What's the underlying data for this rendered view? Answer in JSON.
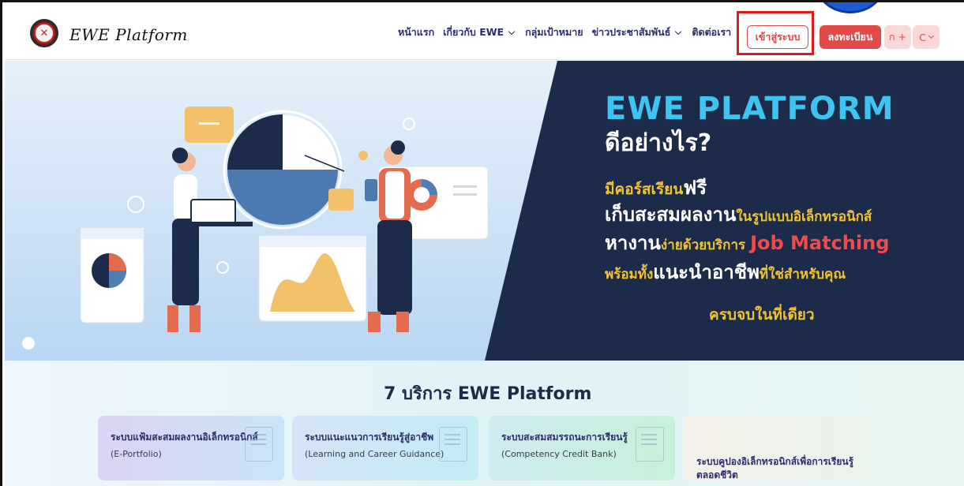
{
  "header": {
    "brand": "EWE Platform",
    "nav": [
      {
        "label": "หน้าแรก",
        "dropdown": false
      },
      {
        "label": "เกี่ยวกับ EWE",
        "dropdown": true
      },
      {
        "label": "กลุ่มเป้าหมาย",
        "dropdown": false
      },
      {
        "label": "ข่าวประชาสัมพันธ์",
        "dropdown": true
      },
      {
        "label": "ติดต่อเรา",
        "dropdown": false
      }
    ],
    "login_label": "เข้าสู่ระบบ",
    "register_label": "ลงทะเบียน",
    "font_size_label": "ก +",
    "contrast_label": "C",
    "accent_color": "#e24a4a"
  },
  "hero": {
    "title": "EWE PLATFORM",
    "subtitle": "ดีอย่างไร?",
    "line1_a": "มีคอร์สเรียน",
    "line1_b": "ฟรี",
    "line2_a": "เก็บสะสมผลงาน",
    "line2_b": "ในรูปแบบอิเล็กทรอนิกส์",
    "line3_a": "หางาน",
    "line3_b": "ง่ายด้วยบริการ",
    "line3_c": "Job Matching",
    "line4_a": "พร้อมทั้ง",
    "line4_b": "แนะนำอาชีพ",
    "line4_c": "ที่ใช่สำหรับคุณ",
    "line5": "ครบจบในที่เดียว"
  },
  "services": {
    "title": "7 บริการ EWE Platform",
    "cards": [
      {
        "title": "ระบบแฟ้มสะสมผลงานอิเล็กทรอนิกส์",
        "subtitle": "(E-Portfolio)"
      },
      {
        "title": "ระบบแนะแนวการเรียนรู้สู่อาชีพ",
        "subtitle": "(Learning and Career Guidance)"
      },
      {
        "title": "ระบบสะสมสมรรถนะการเรียนรู้",
        "subtitle": "(Competency Credit Bank)"
      },
      {
        "title": "ระบบคูปองอิเล็กทรอนิกส์เพื่อการเรียนรู้ตลอดชีวิต",
        "subtitle": ""
      }
    ]
  }
}
